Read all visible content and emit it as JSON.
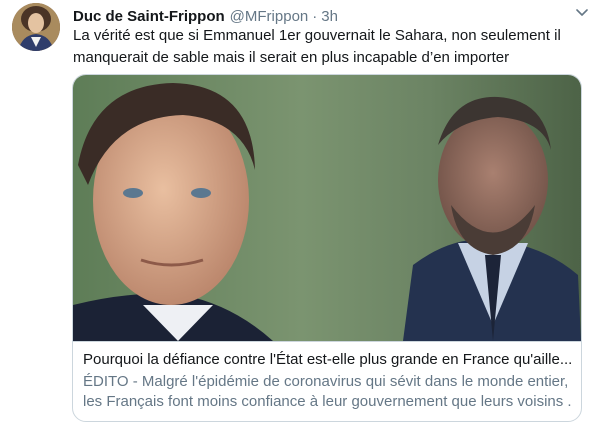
{
  "tweet": {
    "display_name": "Duc de Saint-Frippon",
    "handle": "@MFrippon",
    "separator": "·",
    "time": "3h",
    "avatar_icon": "portrait-avatar",
    "menu_icon": "chevron-down-icon",
    "text_lines": [
      "La vérité est que si Emmanuel 1er gouvernait le Sahara, non seulement il",
      "manquerait de sable mais il serait en plus incapable d’en importer"
    ]
  },
  "card": {
    "image_icon": "article-photo",
    "title": "Pourquoi la défiance contre l'État est-elle plus grande en France qu'aille...",
    "description_lines": [
      "ÉDITO - Malgré l'épidémie de coronavirus qui sévit dans le monde entier,",
      "les Français font moins confiance à leur gouvernement que leurs voisins ..."
    ]
  },
  "colors": {
    "primary_text": "#14171a",
    "secondary_text": "#657786",
    "border": "#ccd6dd"
  }
}
